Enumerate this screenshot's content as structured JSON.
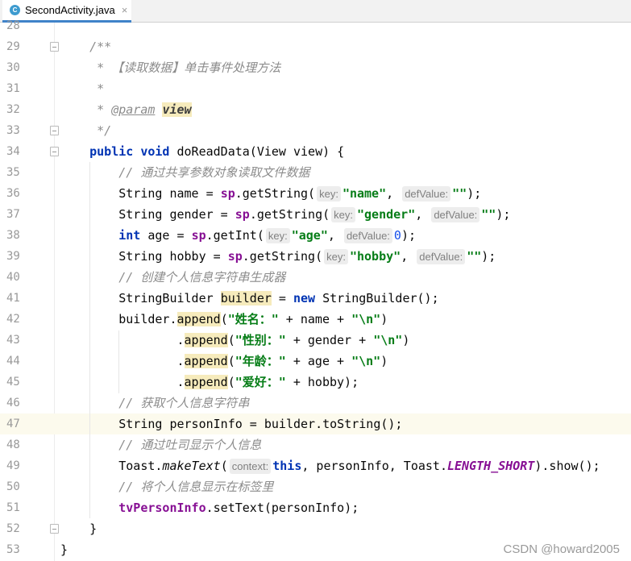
{
  "tab": {
    "icon": "class-icon",
    "icon_letter": "C",
    "title": "SecondActivity.java",
    "close": "×"
  },
  "current_line": 47,
  "colors": {
    "keyword": "#0033b3",
    "string": "#067d17",
    "comment": "#8c8c8c",
    "field": "#871094",
    "number": "#1750eb",
    "highlight": "#f6ebbc",
    "current_line": "#fcfaed"
  },
  "lines": [
    {
      "n": "28",
      "tokens": []
    },
    {
      "n": "29",
      "fold": true,
      "tokens": [
        [
          "cmt",
          "    /**"
        ]
      ]
    },
    {
      "n": "30",
      "tokens": [
        [
          "cmt",
          "     * 【读取数据】单击事件处理方法"
        ]
      ]
    },
    {
      "n": "31",
      "tokens": [
        [
          "cmt",
          "     *"
        ]
      ]
    },
    {
      "n": "32",
      "tokens": [
        [
          "cmt",
          "     * "
        ],
        [
          "doc",
          "@param"
        ],
        [
          "cmt",
          " "
        ],
        [
          "docv",
          "view"
        ]
      ]
    },
    {
      "n": "33",
      "fold": true,
      "tokens": [
        [
          "cmt",
          "     */"
        ]
      ]
    },
    {
      "n": "34",
      "fold": true,
      "tokens": [
        [
          "",
          "    "
        ],
        [
          "kw",
          "public void"
        ],
        [
          "",
          " doReadData(View view) {"
        ]
      ]
    },
    {
      "n": "35",
      "tokens": [
        [
          "cmt",
          "        // 通过共享参数对象读取文件数据"
        ]
      ]
    },
    {
      "n": "36",
      "tokens": [
        [
          "",
          "        String name = "
        ],
        [
          "field",
          "sp"
        ],
        [
          "",
          ".getString("
        ],
        [
          "hint",
          "key:"
        ],
        [
          "str",
          "\"name\""
        ],
        [
          "",
          ", "
        ],
        [
          "hint",
          "defValue:"
        ],
        [
          "str",
          "\"\""
        ],
        [
          "",
          ");"
        ]
      ]
    },
    {
      "n": "37",
      "tokens": [
        [
          "",
          "        String gender = "
        ],
        [
          "field",
          "sp"
        ],
        [
          "",
          ".getString("
        ],
        [
          "hint",
          "key:"
        ],
        [
          "str",
          "\"gender\""
        ],
        [
          "",
          ", "
        ],
        [
          "hint",
          "defValue:"
        ],
        [
          "str",
          "\"\""
        ],
        [
          "",
          ");"
        ]
      ]
    },
    {
      "n": "38",
      "tokens": [
        [
          "",
          "        "
        ],
        [
          "kw",
          "int"
        ],
        [
          "",
          " age = "
        ],
        [
          "field",
          "sp"
        ],
        [
          "",
          ".getInt("
        ],
        [
          "hint",
          "key:"
        ],
        [
          "str",
          "\"age\""
        ],
        [
          "",
          ", "
        ],
        [
          "hint",
          "defValue:"
        ],
        [
          "num",
          "0"
        ],
        [
          "",
          ");"
        ]
      ]
    },
    {
      "n": "39",
      "tokens": [
        [
          "",
          "        String hobby = "
        ],
        [
          "field",
          "sp"
        ],
        [
          "",
          ".getString("
        ],
        [
          "hint",
          "key:"
        ],
        [
          "str",
          "\"hobby\""
        ],
        [
          "",
          ", "
        ],
        [
          "hint",
          "defValue:"
        ],
        [
          "str",
          "\"\""
        ],
        [
          "",
          ");"
        ]
      ]
    },
    {
      "n": "40",
      "tokens": [
        [
          "cmt",
          "        // 创建个人信息字符串生成器"
        ]
      ]
    },
    {
      "n": "41",
      "tokens": [
        [
          "",
          "        StringBuilder "
        ],
        [
          "hl",
          "builder"
        ],
        [
          "",
          " = "
        ],
        [
          "kw",
          "new"
        ],
        [
          "",
          " StringBuilder();"
        ]
      ]
    },
    {
      "n": "42",
      "tokens": [
        [
          "",
          "        builder."
        ],
        [
          "hl",
          "append"
        ],
        [
          "",
          "("
        ],
        [
          "str",
          "\"姓名：\""
        ],
        [
          "",
          " + name + "
        ],
        [
          "str",
          "\"\\n\""
        ],
        [
          "",
          ")"
        ]
      ]
    },
    {
      "n": "43",
      "tokens": [
        [
          "",
          "                ."
        ],
        [
          "hl",
          "append"
        ],
        [
          "",
          "("
        ],
        [
          "str",
          "\"性别：\""
        ],
        [
          "",
          " + gender + "
        ],
        [
          "str",
          "\"\\n\""
        ],
        [
          "",
          ")"
        ]
      ]
    },
    {
      "n": "44",
      "tokens": [
        [
          "",
          "                ."
        ],
        [
          "hl",
          "append"
        ],
        [
          "",
          "("
        ],
        [
          "str",
          "\"年龄：\""
        ],
        [
          "",
          " + age + "
        ],
        [
          "str",
          "\"\\n\""
        ],
        [
          "",
          ")"
        ]
      ]
    },
    {
      "n": "45",
      "tokens": [
        [
          "",
          "                ."
        ],
        [
          "hl",
          "append"
        ],
        [
          "",
          "("
        ],
        [
          "str",
          "\"爱好：\""
        ],
        [
          "",
          " + hobby);"
        ]
      ]
    },
    {
      "n": "46",
      "tokens": [
        [
          "cmt",
          "        // 获取个人信息字符串"
        ]
      ]
    },
    {
      "n": "47",
      "tokens": [
        [
          "",
          "        String personInfo = builder.toString();"
        ]
      ]
    },
    {
      "n": "48",
      "tokens": [
        [
          "cmt",
          "        // 通过吐司显示个人信息"
        ]
      ]
    },
    {
      "n": "49",
      "tokens": [
        [
          "",
          "        Toast."
        ],
        [
          "ital",
          "makeText"
        ],
        [
          "",
          "("
        ],
        [
          "hint",
          "context:"
        ],
        [
          "kw",
          "this"
        ],
        [
          "",
          ", personInfo, Toast."
        ],
        [
          "sfield",
          "LENGTH_SHORT"
        ],
        [
          "",
          ").show();"
        ]
      ]
    },
    {
      "n": "50",
      "tokens": [
        [
          "cmt",
          "        // 将个人信息显示在标签里"
        ]
      ]
    },
    {
      "n": "51",
      "tokens": [
        [
          "",
          "        "
        ],
        [
          "field",
          "tvPersonInfo"
        ],
        [
          "",
          ".setText(personInfo);"
        ]
      ]
    },
    {
      "n": "52",
      "fold": true,
      "tokens": [
        [
          "",
          "    }"
        ]
      ]
    },
    {
      "n": "53",
      "tokens": [
        [
          "",
          "}"
        ]
      ]
    }
  ],
  "watermark": "CSDN @howard2005"
}
